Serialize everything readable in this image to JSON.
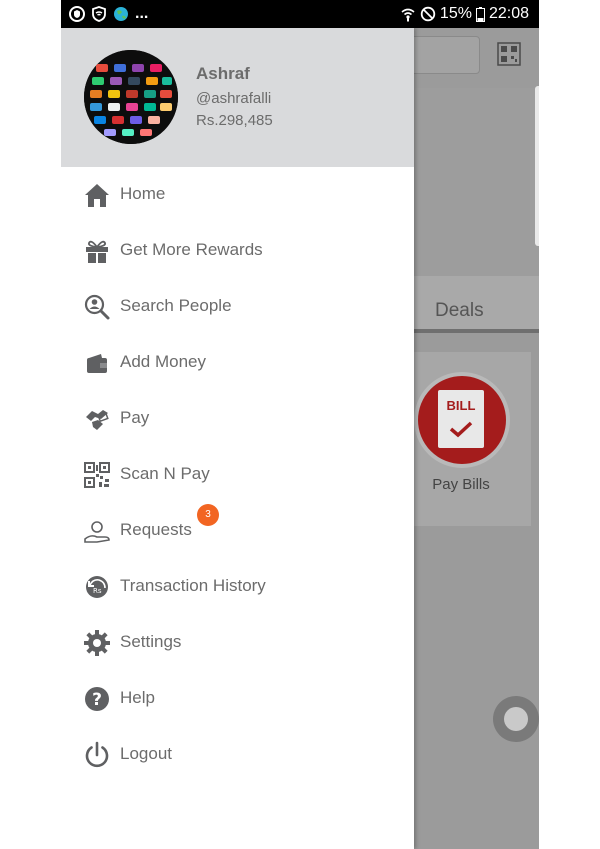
{
  "status_bar": {
    "dots": "...",
    "battery": "15%",
    "time": "22:08"
  },
  "background_app": {
    "tab_deals": "Deals",
    "card_icon_text": "BILL",
    "card_label": "Pay Bills"
  },
  "drawer": {
    "profile": {
      "name": "Ashraf",
      "handle": "@ashrafalli",
      "balance": "Rs.298,485"
    },
    "menu": [
      {
        "label": "Home",
        "icon": "home-icon"
      },
      {
        "label": "Get More Rewards",
        "icon": "gift-icon"
      },
      {
        "label": "Search People",
        "icon": "search-people-icon"
      },
      {
        "label": "Add Money",
        "icon": "wallet-icon"
      },
      {
        "label": "Pay",
        "icon": "pay-icon"
      },
      {
        "label": "Scan N Pay",
        "icon": "qr-code-icon"
      },
      {
        "label": "Requests",
        "icon": "requests-icon",
        "badge": "3"
      },
      {
        "label": "Transaction History",
        "icon": "history-icon"
      },
      {
        "label": "Settings",
        "icon": "gear-icon"
      },
      {
        "label": "Help",
        "icon": "help-icon"
      },
      {
        "label": "Logout",
        "icon": "power-icon"
      }
    ]
  },
  "colors": {
    "drawer_header": "#d9dadc",
    "menu_text": "#6c6c6c",
    "icon_gray": "#5f6062",
    "badge": "#f26522",
    "bill_red": "#a41c1c",
    "overlay_gray": "#9a9a9a"
  }
}
